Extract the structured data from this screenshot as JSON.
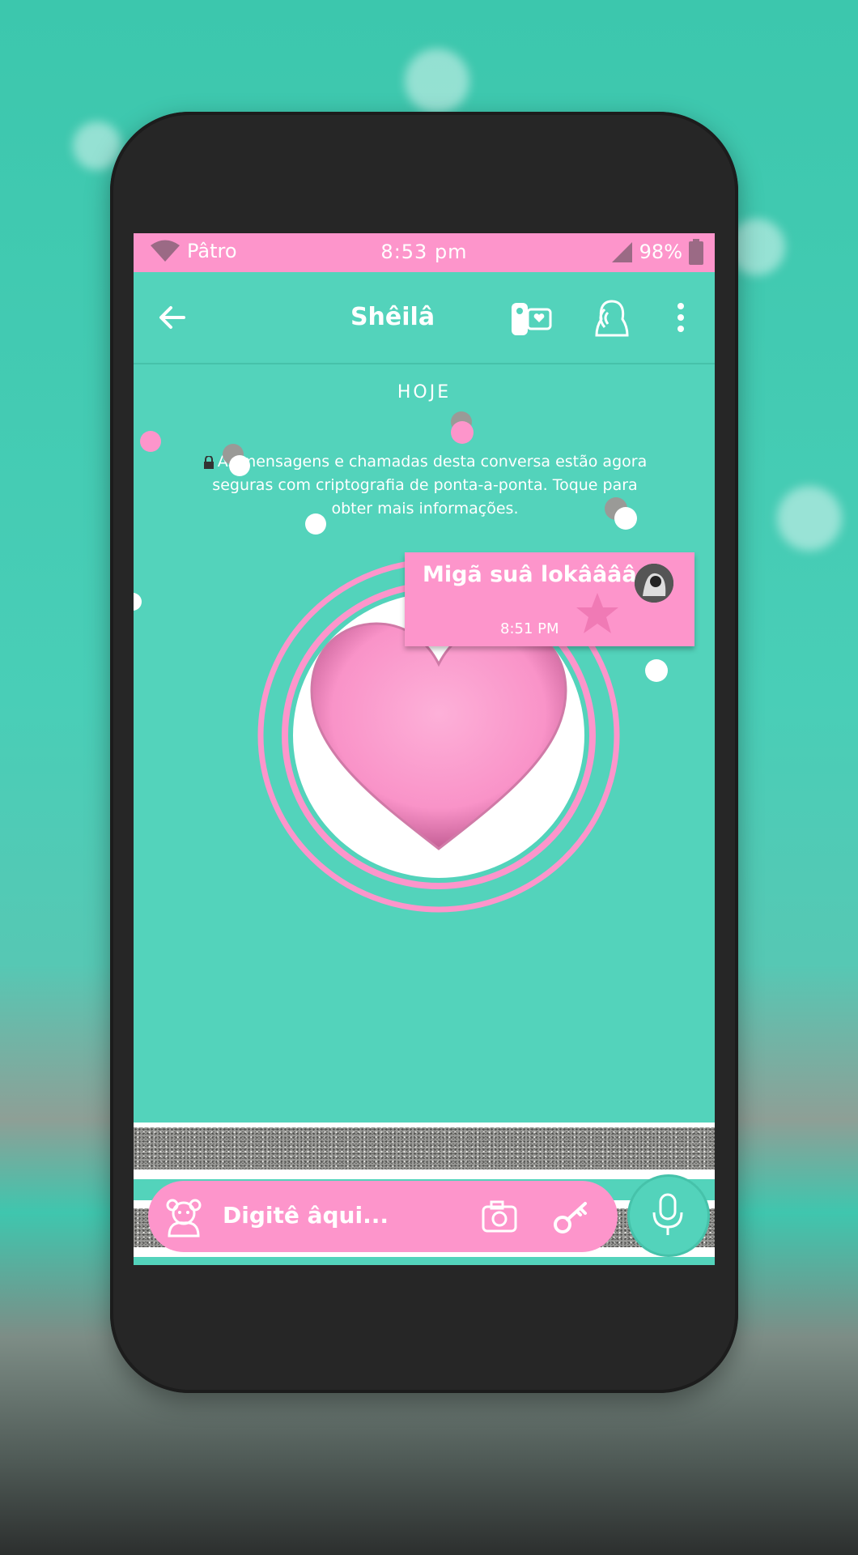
{
  "statusbar": {
    "carrier": "Pâtro",
    "time": "8:53 pm",
    "battery": "98%"
  },
  "appbar": {
    "title": "Shêilâ"
  },
  "chat": {
    "date_label": "HOJE",
    "encryption_notice": "As mensagens e chamadas desta conversa estão agora seguras com criptografia de ponta-a-ponta. Toque para obter mais informações.",
    "message": {
      "text": "Migã suâ lokââââ",
      "time": "8:51 PM"
    }
  },
  "composer": {
    "placeholder": "Digitê âqui..."
  },
  "colors": {
    "pink": "#fd95cb",
    "teal": "#53d3bb",
    "white": "#ffffff",
    "glitter": "#9a9a97"
  },
  "icons": [
    "back-arrow-icon",
    "video-call-icon",
    "voice-call-icon",
    "more-vert-icon",
    "emoji-bear-icon",
    "camera-icon",
    "attach-icon",
    "microphone-icon",
    "lock-icon",
    "heart-icon",
    "wifi-icon",
    "signal-icon",
    "battery-icon"
  ]
}
